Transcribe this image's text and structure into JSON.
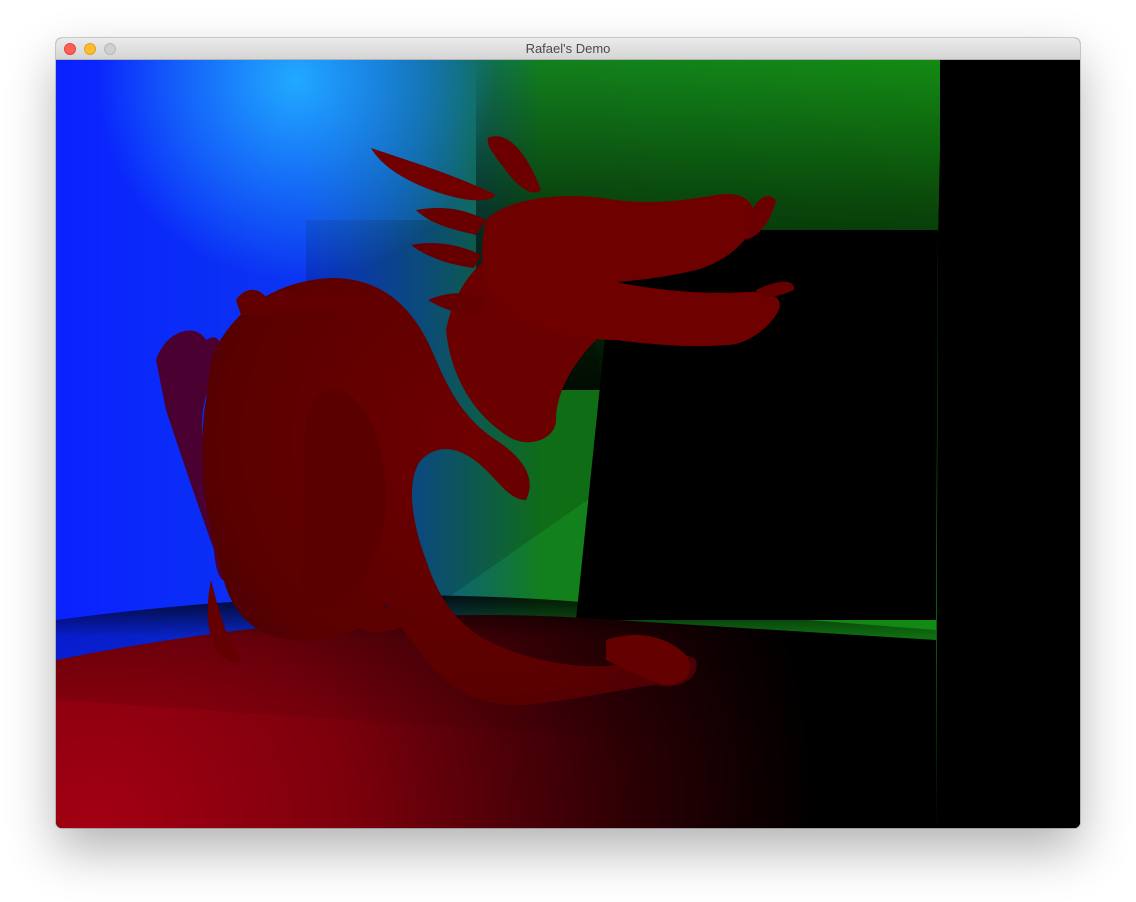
{
  "window": {
    "title": "Rafael's Demo"
  },
  "titlebar_buttons": [
    {
      "name": "close",
      "color": "#fe5f57"
    },
    {
      "name": "minimize",
      "color": "#febc2e"
    },
    {
      "name": "zoom",
      "color": "#cfcfcf"
    }
  ],
  "scene": {
    "description_colors": {
      "back_wall_left": "#0a25ff",
      "back_wall_highlight": "#1ea4ff",
      "back_wall_right": "#138a13",
      "floor": "#9a0010",
      "dragon": "#6b0000",
      "background": "#000000"
    }
  }
}
